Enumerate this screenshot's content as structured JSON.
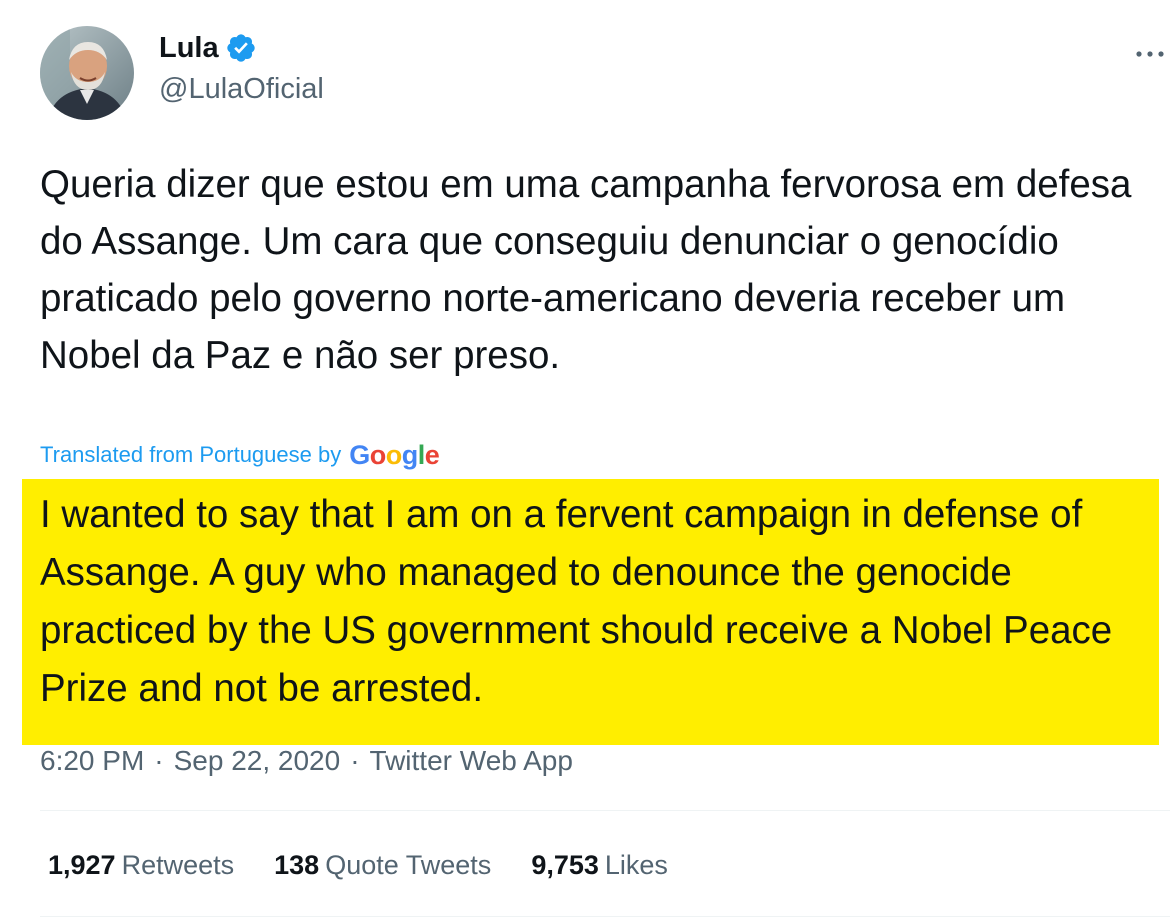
{
  "user": {
    "display_name": "Lula",
    "handle": "@LulaOficial",
    "verified": true,
    "avatar_icon": "profile-photo"
  },
  "tweet": {
    "text": "Queria dizer que estou em uma campanha fervorosa em defesa do Assange. Um cara que conseguiu denunciar o genocídio praticado pelo governo norte-americano deveria receber um Nobel da Paz e não ser preso.",
    "translated_label": "Translated from Portuguese by",
    "translator_logo": "Google",
    "translation": "I wanted to say that I am on a fervent campaign in defense of Assange. A guy who managed to denounce the genocide practiced by the US government should receive a Nobel Peace Prize and not be arrested.",
    "time": "6:20 PM",
    "separator": "·",
    "date": "Sep 22, 2020",
    "source": "Twitter Web App"
  },
  "stats": [
    {
      "count": "1,927",
      "label": "Retweets"
    },
    {
      "count": "138",
      "label": "Quote Tweets"
    },
    {
      "count": "9,753",
      "label": "Likes"
    }
  ],
  "colors": {
    "highlight": "#ffee00",
    "link": "#1d9bf0",
    "verified_badge": "#1d9bf0",
    "secondary_text": "#536471"
  }
}
